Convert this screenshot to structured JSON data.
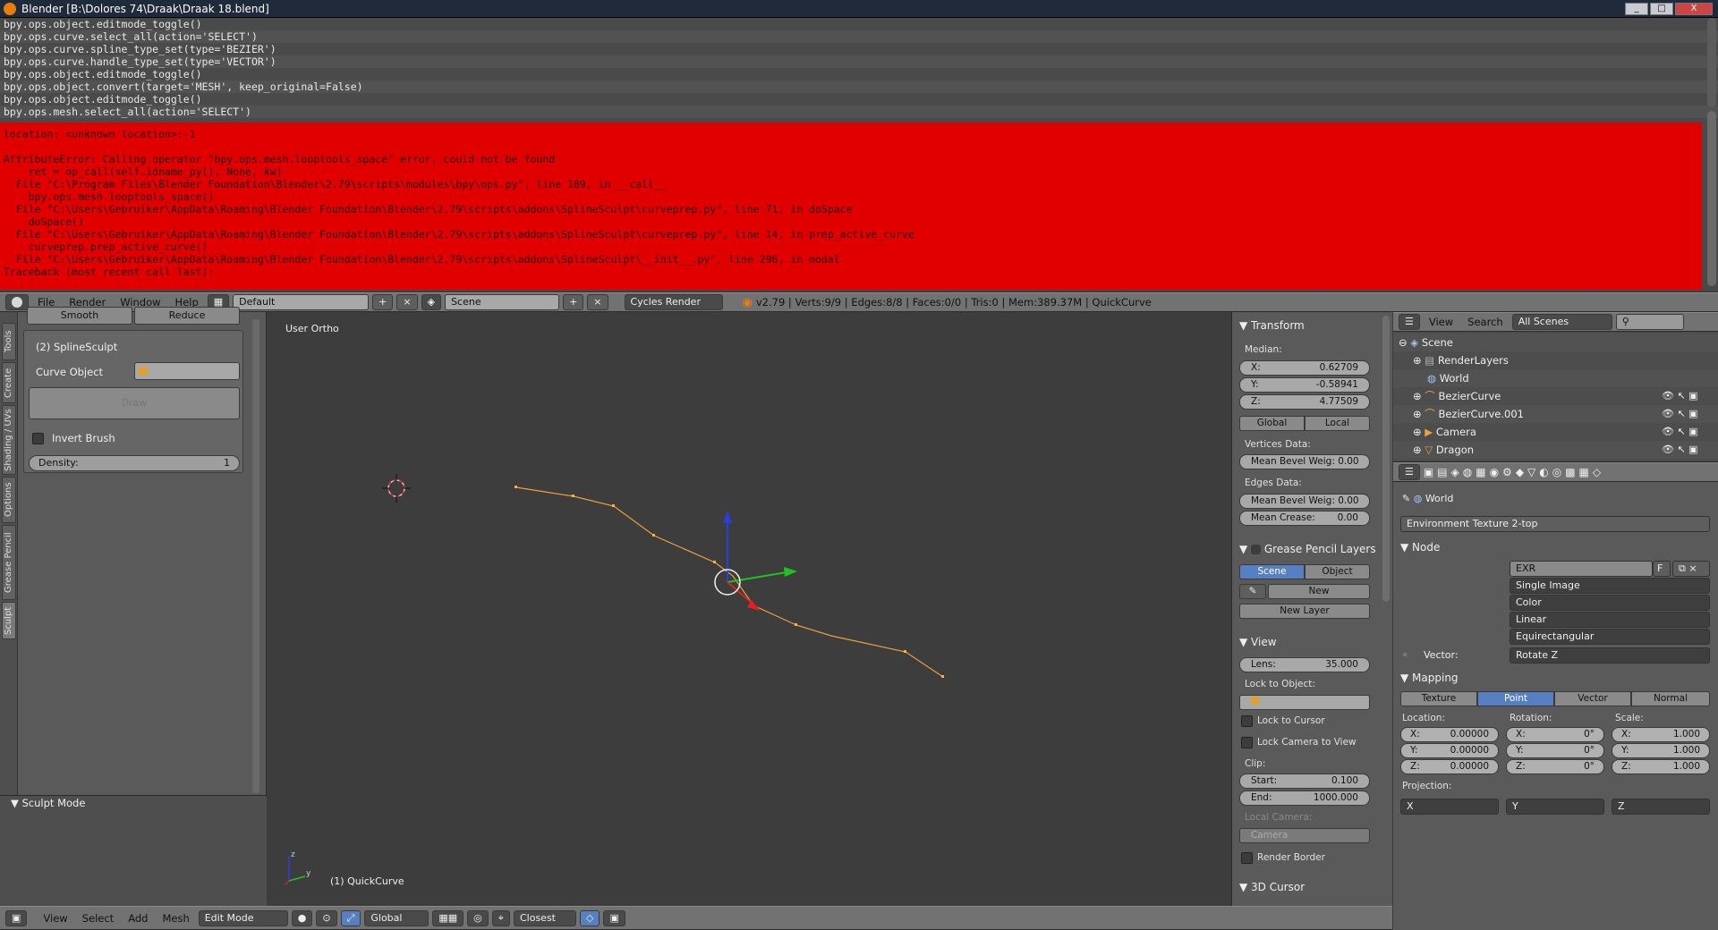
{
  "window": {
    "title": "Blender [B:\\Dolores 74\\Draak\\Draak 18.blend]",
    "buttons": [
      "_",
      "□",
      "X"
    ]
  },
  "console": {
    "lines": [
      "bpy.ops.object.editmode_toggle()",
      "bpy.ops.curve.select_all(action='SELECT')",
      "bpy.ops.curve.spline_type_set(type='BEZIER')",
      "bpy.ops.curve.handle_type_set(type='VECTOR')",
      "bpy.ops.object.editmode_toggle()",
      "bpy.ops.object.convert(target='MESH', keep_original=False)",
      "bpy.ops.object.editmode_toggle()",
      "bpy.ops.mesh.select_all(action='SELECT')"
    ],
    "error_lines": [
      "location: <unknown location>:-1",
      "",
      "AttributeError: Calling operator \"bpy.ops.mesh.looptools_space\" error, could not be found",
      "    ret = op_call(self.idname_py(), None, kw)",
      "  File \"C:\\Program Files\\Blender Foundation\\Blender\\2.79\\scripts\\modules\\bpy\\ops.py\", line 189, in __call__",
      "    bpy.ops.mesh.looptools_space()",
      "  File \"C:\\Users\\Gebruiker\\AppData\\Roaming\\Blender Foundation\\Blender\\2.79\\scripts\\addons\\SplineSculpt\\curveprep.py\", line 71, in doSpace",
      "    doSpace()",
      "  File \"C:\\Users\\Gebruiker\\AppData\\Roaming\\Blender Foundation\\Blender\\2.79\\scripts\\addons\\SplineSculpt\\curveprep.py\", line 14, in prep_active_curve",
      "    curveprep.prep_active_curve()",
      "  File \"C:\\Users\\Gebruiker\\AppData\\Roaming\\Blender Foundation\\Blender\\2.79\\scripts\\addons\\SplineSculpt\\__init__.py\", line 296, in modal",
      "Traceback (most recent call last):"
    ]
  },
  "info_header": {
    "menus": [
      "File",
      "Render",
      "Window",
      "Help"
    ],
    "layout": "Default",
    "scene": "Scene",
    "engine": "Cycles Render",
    "stats": "v2.79 | Verts:9/9 | Edges:8/8 | Faces:0/0 | Tris:0 | Mem:389.37M | QuickCurve"
  },
  "tool_shelf": {
    "tabs": [
      "Tools",
      "Create",
      "Shading / UVs",
      "Options",
      "Grease Pencil",
      "Sculpt"
    ],
    "top_buttons": [
      "Smooth",
      "Reduce"
    ],
    "panel_title": "(2) SplineSculpt",
    "curve_object_label": "Curve Object",
    "draw_label": "Draw",
    "invert_brush_label": "Invert Brush",
    "density_label": "Density:",
    "density_value": "1",
    "mode_panel": "Sculpt Mode"
  },
  "viewport": {
    "view_label": "User Ortho",
    "object_label": "(1) QuickCurve",
    "curve_color": "#e8a33a"
  },
  "n_panel": {
    "transform_title": "Transform",
    "median_label": "Median:",
    "x": {
      "label": "X:",
      "value": "0.62709"
    },
    "y": {
      "label": "Y:",
      "value": "-0.58941"
    },
    "z": {
      "label": "Z:",
      "value": "4.77509"
    },
    "global_label": "Global",
    "local_label": "Local",
    "vertices_data_label": "Vertices Data:",
    "v_mean_bevel": "Mean Bevel Weig: 0.00",
    "edges_data_label": "Edges Data:",
    "e_mean_bevel": "Mean Bevel Weig: 0.00",
    "mean_crease_label": "Mean Crease:",
    "mean_crease_value": "0.00",
    "gp_title": "Grease Pencil Layers",
    "gp_scene": "Scene",
    "gp_object": "Object",
    "gp_new": "New",
    "gp_new_layer": "New Layer",
    "view_title": "View",
    "lens_label": "Lens:",
    "lens_value": "35.000",
    "lock_to_object_label": "Lock to Object:",
    "lock_to_cursor": "Lock to Cursor",
    "lock_camera": "Lock Camera to View",
    "clip_label": "Clip:",
    "clip_start_label": "Start:",
    "clip_start_value": "0.100",
    "clip_end_label": "End:",
    "clip_end_value": "1000.000",
    "local_camera_label": "Local Camera:",
    "camera_value": "Camera",
    "render_border": "Render Border",
    "cursor_title": "3D Cursor"
  },
  "outliner": {
    "menus": [
      "View",
      "Search"
    ],
    "filter": "All Scenes",
    "rows": [
      {
        "label": "Scene",
        "indent": 0
      },
      {
        "label": "RenderLayers",
        "indent": 1
      },
      {
        "label": "World",
        "indent": 1
      },
      {
        "label": "BezierCurve",
        "indent": 1
      },
      {
        "label": "BezierCurve.001",
        "indent": 1
      },
      {
        "label": "Camera",
        "indent": 1
      },
      {
        "label": "Dragon",
        "indent": 1
      }
    ]
  },
  "properties": {
    "breadcrumb": "World",
    "node_tree": "Environment Texture 2-top",
    "node_title": "Node",
    "image_name": "EXR",
    "image_f": "F",
    "source": "Single Image",
    "color": "Color",
    "interpolation": "Linear",
    "projection_mode": "Equirectangular",
    "vector_label": "Vector:",
    "vector_value": "Rotate Z",
    "mapping_title": "Mapping",
    "mapping_tabs": [
      "Texture",
      "Point",
      "Vector",
      "Normal"
    ],
    "mapping_active": "Point",
    "location_label": "Location:",
    "rotation_label": "Rotation:",
    "scale_label": "Scale:",
    "location": [
      {
        "l": "X:",
        "v": "0.00000"
      },
      {
        "l": "Y:",
        "v": "0.00000"
      },
      {
        "l": "Z:",
        "v": "0.00000"
      }
    ],
    "rotation": [
      {
        "l": "X:",
        "v": "0°"
      },
      {
        "l": "Y:",
        "v": "0°"
      },
      {
        "l": "Z:",
        "v": "0°"
      }
    ],
    "scale": [
      {
        "l": "X:",
        "v": "1.000"
      },
      {
        "l": "Y:",
        "v": "1.000"
      },
      {
        "l": "Z:",
        "v": "1.000"
      }
    ],
    "projection_label": "Projection:",
    "projection_axes": [
      "X",
      "Y",
      "Z"
    ]
  },
  "bottom_header": {
    "menus": [
      "View",
      "Select",
      "Add",
      "Mesh"
    ],
    "mode": "Edit Mode",
    "orientation": "Global",
    "snap": "Closest"
  }
}
